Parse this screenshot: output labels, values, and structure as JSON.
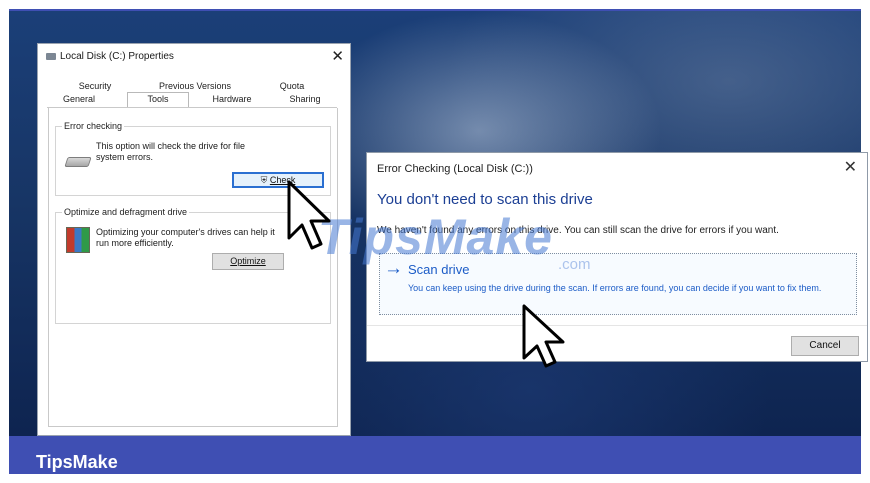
{
  "brand": {
    "footer_label": "TipsMake"
  },
  "watermark": {
    "text": "TipsMake",
    "suffix": ".com"
  },
  "properties_window": {
    "title": "Local Disk (C:) Properties",
    "tabs_row1": [
      "Security",
      "Previous Versions",
      "Quota"
    ],
    "tabs_row2": [
      "General",
      "Tools",
      "Hardware",
      "Sharing"
    ],
    "active_tab": "Tools",
    "error_checking": {
      "legend": "Error checking",
      "description": "This option will check the drive for file system errors.",
      "button": "Check"
    },
    "optimize": {
      "legend": "Optimize and defragment drive",
      "description": "Optimizing your computer's drives can help it run more efficiently.",
      "button": "Optimize"
    }
  },
  "error_dialog": {
    "title": "Error Checking (Local Disk (C:))",
    "heading": "You don't need to scan this drive",
    "message": "We haven't found any errors on this drive. You can still scan the drive for errors if you want.",
    "scan_link": {
      "title": "Scan drive",
      "description": "You can keep using the drive during the scan. If errors are found, you can decide if you want to fix them."
    },
    "cancel_button": "Cancel"
  },
  "colors": {
    "frame": "#3f4fb3",
    "heading_blue": "#1c3f94",
    "link_blue": "#1c5cc7"
  },
  "icons": [
    "drive-icon",
    "shield-icon",
    "defrag-icon",
    "close-icon",
    "arrow-right-icon",
    "cursor-icon"
  ]
}
